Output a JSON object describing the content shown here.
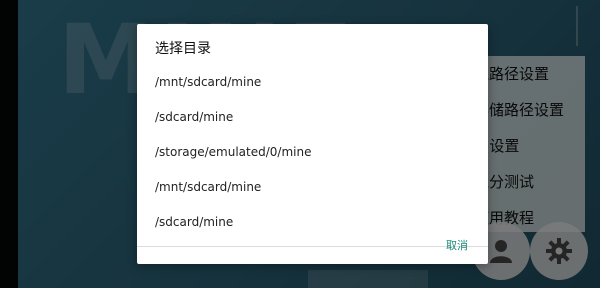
{
  "background": {
    "logo_text": "MINE",
    "menu_items": [
      "线路径设置",
      "存储路径设置",
      "UI设置",
      "跑分测试",
      "使用教程"
    ],
    "fab_icons": [
      "person-icon",
      "gear-icon"
    ]
  },
  "dialog": {
    "title": "选择目录",
    "directories": [
      "/mnt/sdcard/mine",
      "/sdcard/mine",
      "/storage/emulated/0/mine",
      "/mnt/sdcard/mine",
      "/sdcard/mine"
    ],
    "cancel_label": "取消"
  },
  "colors": {
    "accent": "#1a8a7a",
    "background_teal": "#2a6075",
    "dialog_bg": "#ffffff"
  }
}
